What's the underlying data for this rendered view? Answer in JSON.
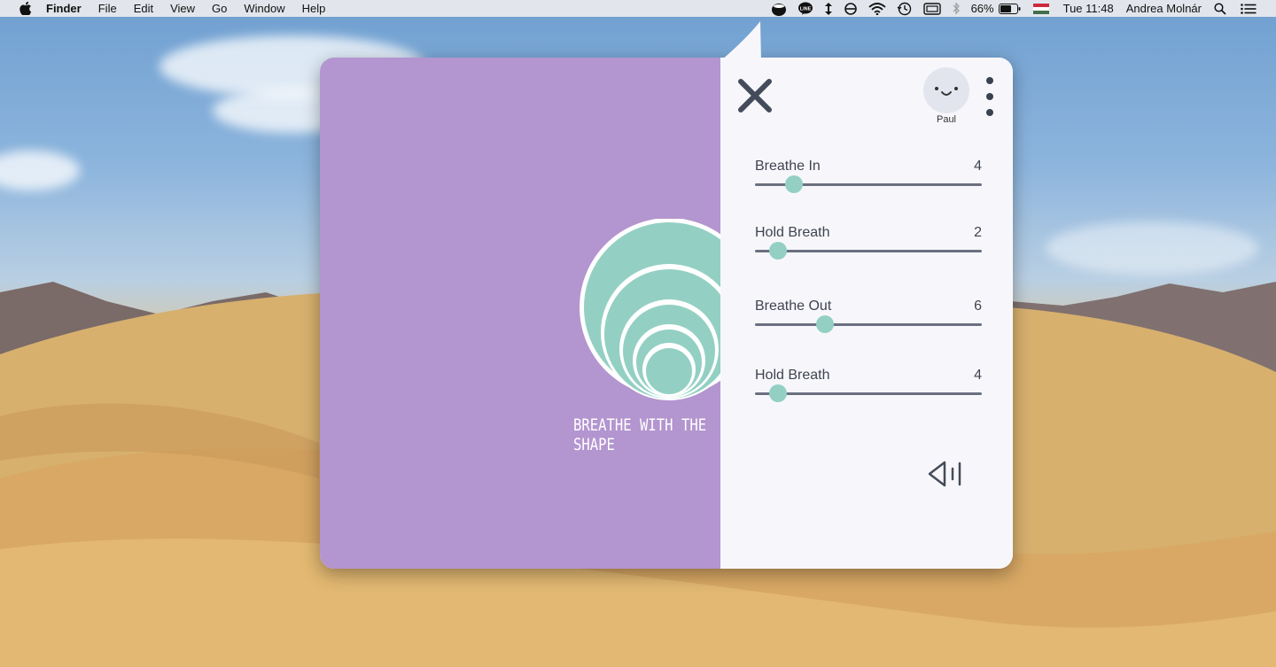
{
  "menubar": {
    "app_name": "Finder",
    "menus": [
      "File",
      "Edit",
      "View",
      "Go",
      "Window",
      "Help"
    ],
    "battery_percent": "66%",
    "clock": "Tue 11:48",
    "user": "Andrea Molnár",
    "icons": [
      "apple-icon",
      "breathe-app-icon",
      "line-app-icon",
      "arrows-icon",
      "sync-icon",
      "wifi-icon",
      "time-machine-icon",
      "display-icon",
      "bluetooth-icon",
      "battery-icon",
      "flag-icon",
      "spotlight-icon",
      "notification-center-icon"
    ]
  },
  "popover": {
    "tagline": "BREATHE WITH THE SHAPE",
    "profile": {
      "name": "Paul",
      "avatar_icon": "smiley-face-icon"
    },
    "sliders": [
      {
        "label": "Breathe In",
        "value": "4",
        "fraction": 0.17
      },
      {
        "label": "Hold Breath",
        "value": "2",
        "fraction": 0.1
      },
      {
        "label": "Breathe Out",
        "value": "6",
        "fraction": 0.31
      },
      {
        "label": "Hold Breath",
        "value": "4",
        "fraction": 0.1
      }
    ],
    "icons": [
      "close-icon",
      "more-options-icon",
      "sound-icon"
    ],
    "colors": {
      "left_panel": "#b395cf",
      "accent_teal": "#93d0c3",
      "right_panel": "#f7f7fb",
      "text_dark": "#3f4450"
    }
  }
}
